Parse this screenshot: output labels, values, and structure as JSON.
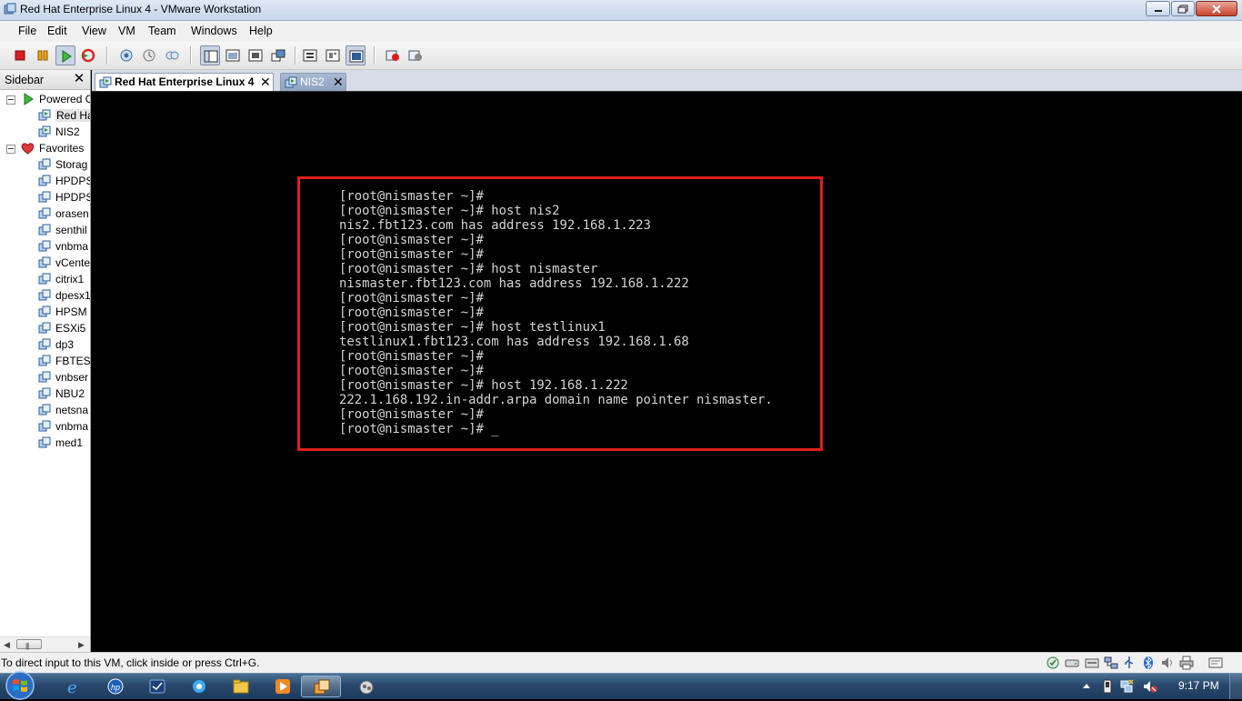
{
  "window": {
    "title": "Red Hat Enterprise Linux 4 - VMware Workstation",
    "controls": [
      "minimize-icon",
      "maximize-icon",
      "close-icon"
    ]
  },
  "menu": [
    "File",
    "Edit",
    "View",
    "VM",
    "Team",
    "Windows",
    "Help"
  ],
  "toolbar": {
    "buttons": [
      "power-off-icon",
      "suspend-icon",
      "power-on-icon",
      "reset-icon",
      "snapshot-icon",
      "revert-snapshot-icon",
      "snapshot-manager-icon",
      "show-sidebar-icon",
      "quick-switch-icon",
      "full-screen-icon",
      "unity-icon",
      "summary-icon",
      "appliance-view-icon",
      "console-view-icon",
      "record-icon",
      "replay-icon"
    ]
  },
  "sidebar": {
    "title": "Sidebar",
    "close": "✕",
    "groups": [
      {
        "label": "Powered O",
        "icon": "play-icon",
        "items": [
          "Red Ha",
          "NIS2"
        ]
      },
      {
        "label": "Favorites",
        "icon": "heart-icon",
        "items": [
          "Storag",
          "HPDPS",
          "HPDPS",
          "orasen",
          "senthil",
          "vnbma",
          "vCente",
          "citrix1",
          "dpesx1",
          "HPSM",
          "ESXi5",
          "dp3",
          "FBTES1",
          "vnbser",
          "NBU2",
          "netsna",
          "vnbma",
          "med1"
        ]
      }
    ]
  },
  "tabs": [
    {
      "label": "Red Hat Enterprise Linux 4",
      "active": true,
      "close": "✕"
    },
    {
      "label": "NIS2",
      "active": false,
      "close": "✕"
    }
  ],
  "terminal": {
    "lines": [
      "[root@nismaster ~]#",
      "[root@nismaster ~]# host nis2",
      "nis2.fbt123.com has address 192.168.1.223",
      "[root@nismaster ~]#",
      "[root@nismaster ~]#",
      "[root@nismaster ~]# host nismaster",
      "nismaster.fbt123.com has address 192.168.1.222",
      "[root@nismaster ~]#",
      "[root@nismaster ~]#",
      "[root@nismaster ~]# host testlinux1",
      "testlinux1.fbt123.com has address 192.168.1.68",
      "[root@nismaster ~]#",
      "[root@nismaster ~]#",
      "[root@nismaster ~]# host 192.168.1.222",
      "222.1.168.192.in-addr.arpa domain name pointer nismaster.",
      "[root@nismaster ~]#",
      "[root@nismaster ~]# _"
    ],
    "highlight_color": "#e01e1e"
  },
  "statusbar": {
    "message": "To direct input to this VM, click inside or press Ctrl+G.",
    "devices": [
      "vmware-tools-icon",
      "hard-disk-icon",
      "cd-rom-icon",
      "network-icon",
      "usb-icon",
      "bluetooth-icon",
      "sound-icon",
      "printer-icon",
      "message-icon"
    ]
  },
  "taskbar": {
    "apps": [
      "internet-explorer-icon",
      "hp-icon",
      "outlook-icon",
      "browser-icon",
      "explorer-icon",
      "media-player-icon",
      "vmware-workstation-icon",
      "network-app-icon"
    ],
    "tray": [
      "show-hidden-icons",
      "device-icon",
      "network-tray-icon",
      "volume-muted-icon"
    ],
    "clock": "9:17 PM"
  }
}
